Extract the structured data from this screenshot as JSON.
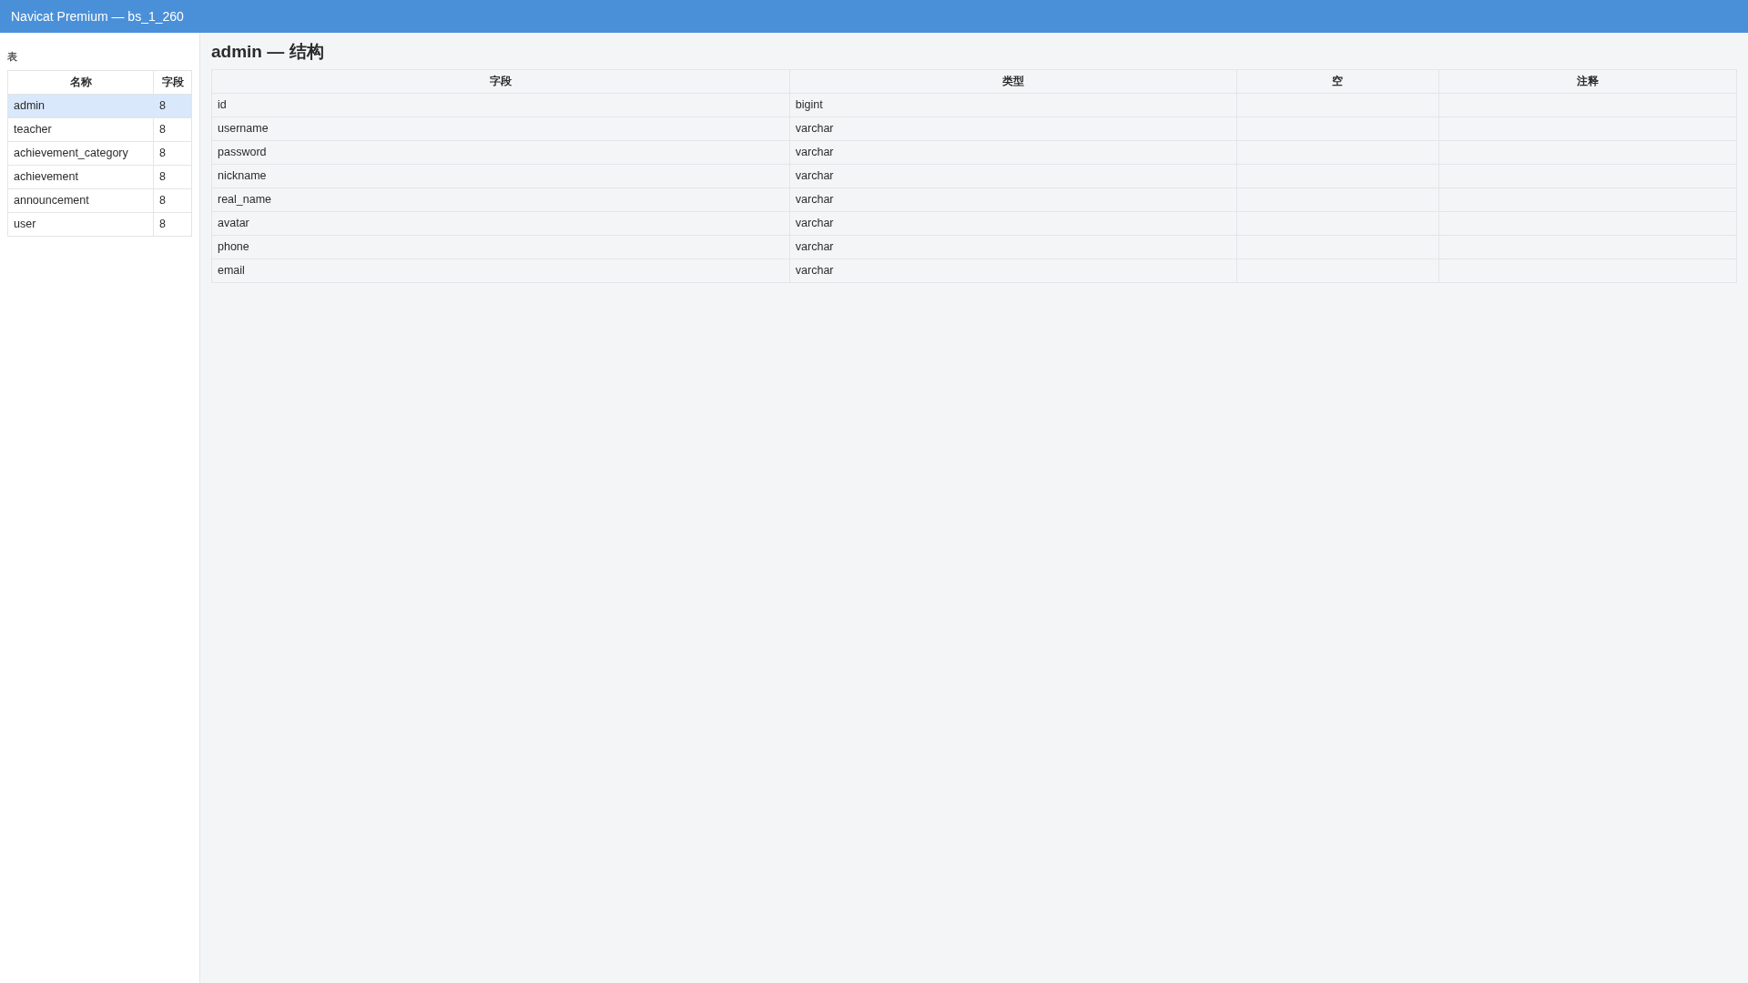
{
  "window": {
    "title": "Navicat Premium — bs_1_260"
  },
  "sidebar": {
    "label": "表",
    "columns": [
      "名称",
      "字段"
    ],
    "items": [
      {
        "name": "admin",
        "count": "8",
        "selected": true
      },
      {
        "name": "teacher",
        "count": "8",
        "selected": false
      },
      {
        "name": "achievement_category",
        "count": "8",
        "selected": false
      },
      {
        "name": "achievement",
        "count": "8",
        "selected": false
      },
      {
        "name": "announcement",
        "count": "8",
        "selected": false
      },
      {
        "name": "user",
        "count": "8",
        "selected": false
      }
    ]
  },
  "main": {
    "heading": "admin — 结构",
    "table": {
      "columns": [
        "字段",
        "类型",
        "空",
        "注释"
      ],
      "rows": [
        {
          "field": "id",
          "type": "bigint"
        },
        {
          "field": "username",
          "type": "varchar"
        },
        {
          "field": "password",
          "type": "varchar"
        },
        {
          "field": "nickname",
          "type": "varchar"
        },
        {
          "field": "real_name",
          "type": "varchar"
        },
        {
          "field": "avatar",
          "type": "varchar"
        },
        {
          "field": "phone",
          "type": "varchar"
        },
        {
          "field": "email",
          "type": "varchar"
        }
      ]
    }
  }
}
